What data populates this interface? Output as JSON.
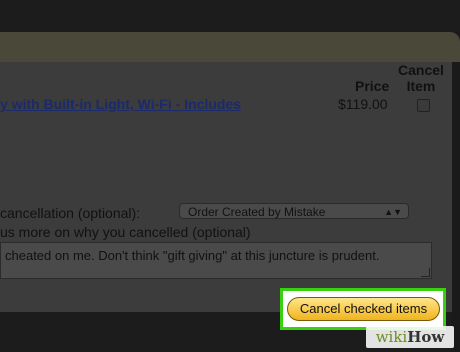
{
  "columns": {
    "price": "Price",
    "cancel_line1": "Cancel",
    "cancel_line2": "Item"
  },
  "item": {
    "title": "y with Built-in Light, Wi-Fi - Includes",
    "price": "$119.00",
    "checked": false
  },
  "reason": {
    "label": "cancellation (optional):",
    "selected": "Order Created by Mistake"
  },
  "comments": {
    "label": "us more on why you cancelled (optional)",
    "value": "cheated on me. Don't think \"gift giving\" at this juncture is prudent."
  },
  "actions": {
    "cancel_label": "Cancel checked items"
  },
  "watermark": {
    "wiki": "wiki",
    "how": "How"
  },
  "colors": {
    "highlight": "#37d10f",
    "button": "#f0b41f",
    "link": "#1b2a6b"
  }
}
